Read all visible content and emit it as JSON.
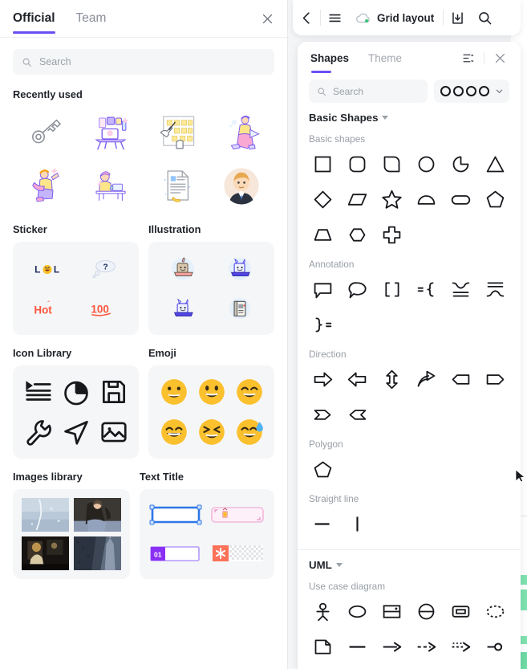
{
  "left_panel": {
    "tabs": [
      {
        "label": "Official",
        "active": true
      },
      {
        "label": "Team",
        "active": false
      }
    ],
    "close_icon": "close-icon",
    "search": {
      "placeholder": "Search",
      "icon": "search-icon"
    },
    "sections": {
      "recently_used": {
        "title": "Recently used",
        "items": [
          "key-illustration",
          "workstation-desk-illustration",
          "sticky-note-wall-illustration",
          "person-with-laptop-illustration",
          "person-reading-book-illustration",
          "person-at-desk-illustration",
          "document-page-illustration",
          "businessman-avatar-illustration"
        ]
      },
      "sticker": {
        "title": "Sticker",
        "items": [
          "lol-sticker",
          "question-thought-sticker",
          "hot-sticker",
          "hundred-points-sticker"
        ]
      },
      "illustration": {
        "title": "Illustration",
        "items": [
          "robot-laptop-beige",
          "robot-laptop-blue",
          "robot-laptop-purple",
          "book-icon-blue"
        ]
      },
      "icon_library": {
        "title": "Icon Library",
        "items": [
          "indent-list-icon",
          "pie-chart-icon",
          "save-disk-icon",
          "wrench-icon",
          "send-paper-plane-icon",
          "image-picture-icon"
        ]
      },
      "emoji": {
        "title": "Emoji",
        "items": [
          "grinning-face",
          "grinning-open-mouth",
          "smiling-closed-eyes",
          "beaming-face",
          "squinting-laugh",
          "sweat-smile"
        ]
      },
      "images_library": {
        "title": "Images library",
        "items": [
          "frozen-texture-photo",
          "woman-portrait-photo",
          "dark-interior-photo",
          "city-tower-photo"
        ]
      },
      "text_title": {
        "title": "Text Title",
        "items": [
          "blue-outline-textbox",
          "pink-corner-textbox",
          "numbered-01-textbox",
          "orange-asterisk-textbox"
        ]
      }
    }
  },
  "topbar": {
    "back_icon": "chevron-left-icon",
    "menu_icon": "hamburger-menu-icon",
    "cloud_icon": "cloud-synced-icon",
    "title": "Grid layout",
    "download_icon": "download-icon",
    "search_icon": "search-icon"
  },
  "shapes_panel": {
    "tabs": [
      {
        "label": "Shapes",
        "active": true
      },
      {
        "label": "Theme",
        "active": false
      }
    ],
    "sort_icon": "sort-list-icon",
    "close_icon": "close-icon",
    "search": {
      "placeholder": "Search",
      "icon": "search-icon"
    },
    "style_selector": {
      "icon": "stroke-style-circles",
      "circles": 4,
      "chevron": "chevron-down-icon"
    },
    "groups": [
      {
        "name": "Basic Shapes",
        "caret": "caret-down-icon",
        "subgroups": [
          {
            "name": "Basic shapes",
            "shapes": [
              "square",
              "rounded-square",
              "half-rounded-square",
              "circle",
              "pie-arc",
              "triangle",
              "diamond",
              "parallelogram",
              "star",
              "semicircle",
              "pill-oval",
              "pentagon",
              "trapezoid",
              "hexagon",
              "cross-plus"
            ]
          },
          {
            "name": "Annotation",
            "shapes": [
              "square-speech-bubble",
              "round-speech-bubble",
              "square-brackets",
              "left-brace",
              "brace-down",
              "brace-up",
              "right-brace"
            ]
          },
          {
            "name": "Direction",
            "shapes": [
              "arrow-right",
              "arrow-left",
              "arrow-bidirectional",
              "curved-arrow",
              "pentagon-arrow-left",
              "pentagon-arrow-right",
              "chevron-arrow-right",
              "chevron-arrow-left"
            ]
          },
          {
            "name": "Polygon",
            "shapes": [
              "pentagon-polygon"
            ]
          },
          {
            "name": "Straight line",
            "shapes": [
              "horizontal-line",
              "vertical-line"
            ]
          }
        ]
      },
      {
        "name": "UML",
        "caret": "caret-down-icon",
        "subgroups": [
          {
            "name": "Use case diagram",
            "shapes": [
              "uml-actor",
              "uml-use-case-ellipse",
              "uml-system-boundary",
              "uml-ellipse-divided",
              "uml-rounded-box",
              "uml-dashed-ellipse",
              "uml-note",
              "uml-association-line",
              "uml-arrow",
              "uml-dashed-arrow",
              "uml-dotted-arrow",
              "uml-circle-connector"
            ]
          }
        ]
      }
    ]
  },
  "cursor": {
    "icon": "mouse-pointer-cursor"
  },
  "colors": {
    "accent": "#6b4ef5",
    "panel_bg": "#ffffff",
    "card_bg": "#f5f6f7",
    "text_primary": "#1f2329",
    "text_muted": "#9aa0a8",
    "canvas_note_green": "#7ee2b0"
  }
}
